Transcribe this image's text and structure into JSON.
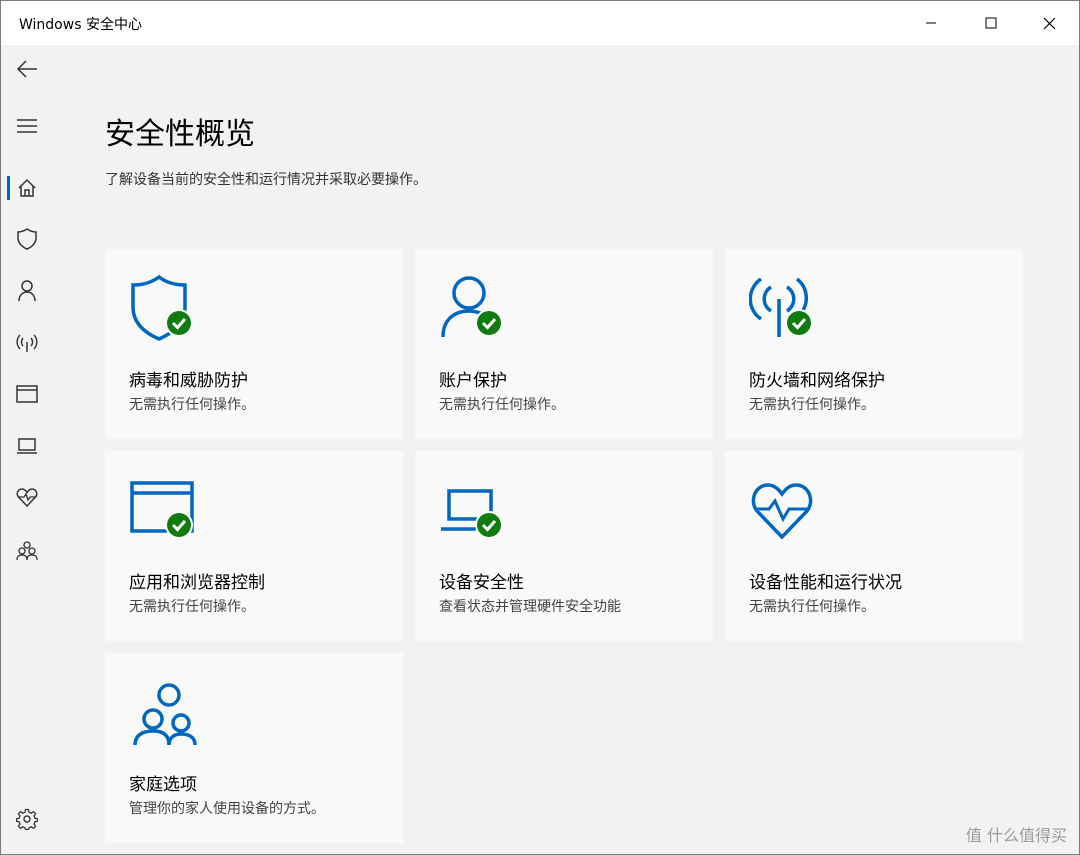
{
  "window": {
    "title": "Windows 安全中心"
  },
  "sidebar": {
    "items": [
      {
        "name": "back",
        "icon": "back-arrow-icon"
      },
      {
        "name": "menu",
        "icon": "hamburger-icon"
      },
      {
        "name": "home",
        "icon": "home-icon",
        "active": true
      },
      {
        "name": "virus-protection",
        "icon": "shield-icon"
      },
      {
        "name": "account-protection",
        "icon": "person-icon"
      },
      {
        "name": "firewall",
        "icon": "wireless-icon"
      },
      {
        "name": "app-browser",
        "icon": "browser-window-icon"
      },
      {
        "name": "device-security",
        "icon": "laptop-icon"
      },
      {
        "name": "device-health",
        "icon": "heart-pulse-icon"
      },
      {
        "name": "family",
        "icon": "family-icon"
      },
      {
        "name": "settings",
        "icon": "gear-icon"
      }
    ]
  },
  "main": {
    "title": "安全性概览",
    "subtitle": "了解设备当前的安全性和运行情况并采取必要操作。",
    "tiles": [
      {
        "name": "病毒和威胁防护",
        "desc": "无需执行任何操作。",
        "icon": "shield-icon",
        "status": "ok"
      },
      {
        "name": "账户保护",
        "desc": "无需执行任何操作。",
        "icon": "person-icon",
        "status": "ok"
      },
      {
        "name": "防火墙和网络保护",
        "desc": "无需执行任何操作。",
        "icon": "wireless-icon",
        "status": "ok"
      },
      {
        "name": "应用和浏览器控制",
        "desc": "无需执行任何操作。",
        "icon": "browser-window-icon",
        "status": "ok"
      },
      {
        "name": "设备安全性",
        "desc": "查看状态并管理硬件安全功能",
        "icon": "laptop-icon",
        "status": "ok"
      },
      {
        "name": "设备性能和运行状况",
        "desc": "无需执行任何操作。",
        "icon": "heart-pulse-icon",
        "status": "none"
      },
      {
        "name": "家庭选项",
        "desc": "管理你的家人使用设备的方式。",
        "icon": "family-icon",
        "status": "none"
      }
    ]
  },
  "colors": {
    "accent": "#0067c0",
    "ok": "#107c10"
  },
  "watermark": {
    "text": "值 什么值得买"
  }
}
